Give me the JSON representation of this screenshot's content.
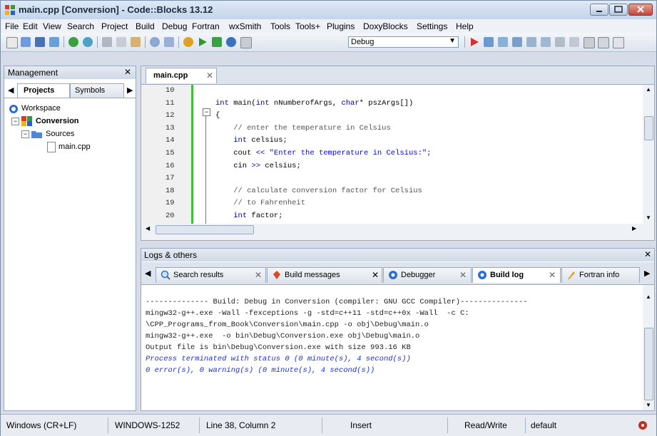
{
  "window": {
    "title": "main.cpp [Conversion] - Code::Blocks 13.12",
    "accent": "#c4d4ea"
  },
  "menu": [
    "File",
    "Edit",
    "View",
    "Search",
    "Project",
    "Build",
    "Debug",
    "Fortran",
    "wxSmith",
    "Tools",
    "Tools+",
    "Plugins",
    "DoxyBlocks",
    "Settings",
    "Help"
  ],
  "toolbar": {
    "build_target": "Debug"
  },
  "management": {
    "title": "Management",
    "close": "✕",
    "tabs": [
      "Projects",
      "Symbols"
    ],
    "tree": {
      "workspace": "Workspace",
      "project": "Conversion",
      "folder": "Sources",
      "file": "main.cpp"
    }
  },
  "editor": {
    "tab": "main.cpp",
    "lines": [
      {
        "no": "10",
        "code": ""
      },
      {
        "no": "11",
        "code": "int main(int nNumberofArgs, char* pszArgs[])"
      },
      {
        "no": "12",
        "code": "{"
      },
      {
        "no": "13",
        "code": "    // enter the temperature in Celsius"
      },
      {
        "no": "14",
        "code": "    int celsius;"
      },
      {
        "no": "15",
        "code": "    cout << \"Enter the temperature in Celsius:\";"
      },
      {
        "no": "16",
        "code": "    cin >> celsius;"
      },
      {
        "no": "17",
        "code": ""
      },
      {
        "no": "18",
        "code": "    // calculate conversion factor for Celsius"
      },
      {
        "no": "19",
        "code": "    // to Fahrenheit"
      },
      {
        "no": "20",
        "code": "    int factor;"
      }
    ]
  },
  "logs": {
    "title": "Logs & others",
    "close": "✕",
    "tabs": [
      "Search results",
      "Build messages",
      "Debugger",
      "Build log",
      "Fortran info"
    ],
    "active_tab": "Build log",
    "lines": [
      {
        "text": "-------------- Build: Debug in Conversion (compiler: GNU GCC Compiler)---------------",
        "style": "normal"
      },
      {
        "text": "mingw32-g++.exe -Wall -fexceptions -g -std=c++11 -std=c++0x -Wall  -c C:",
        "style": "normal"
      },
      {
        "text": "\\CPP_Programs_from_Book\\Conversion\\main.cpp -o obj\\Debug\\main.o",
        "style": "normal"
      },
      {
        "text": "mingw32-g++.exe  -o bin\\Debug\\Conversion.exe obj\\Debug\\main.o",
        "style": "normal"
      },
      {
        "text": "Output file is bin\\Debug\\Conversion.exe with size 993.16 KB",
        "style": "normal"
      },
      {
        "text": "Process terminated with status 0 (0 minute(s), 4 second(s))",
        "style": "blue"
      },
      {
        "text": "0 error(s), 0 warning(s) (0 minute(s), 4 second(s))",
        "style": "blue"
      }
    ]
  },
  "status": {
    "line_ending": "Windows (CR+LF)",
    "encoding": "WINDOWS-1252",
    "position": "Line 38, Column 2",
    "mode": "Insert",
    "access": "Read/Write",
    "profile": "default"
  }
}
